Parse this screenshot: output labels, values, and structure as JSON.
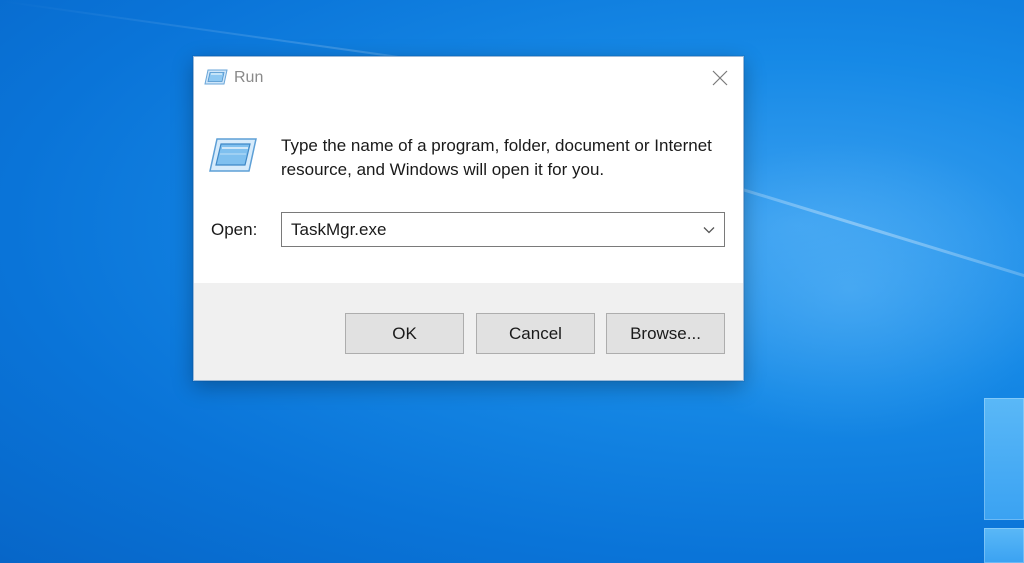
{
  "window": {
    "title": "Run",
    "close_icon": "close-icon",
    "app_icon": "run-icon"
  },
  "prompt": {
    "description": "Type the name of a program, folder, document or Internet resource, and Windows will open it for you."
  },
  "open_field": {
    "label": "Open:",
    "value": "TaskMgr.exe",
    "dropdown_icon": "chevron-down-icon"
  },
  "buttons": {
    "ok": "OK",
    "cancel": "Cancel",
    "browse": "Browse..."
  },
  "colors": {
    "desktop": "#1689e6",
    "dialog_footer": "#f0f0f0",
    "button_face": "#e1e1e1"
  }
}
